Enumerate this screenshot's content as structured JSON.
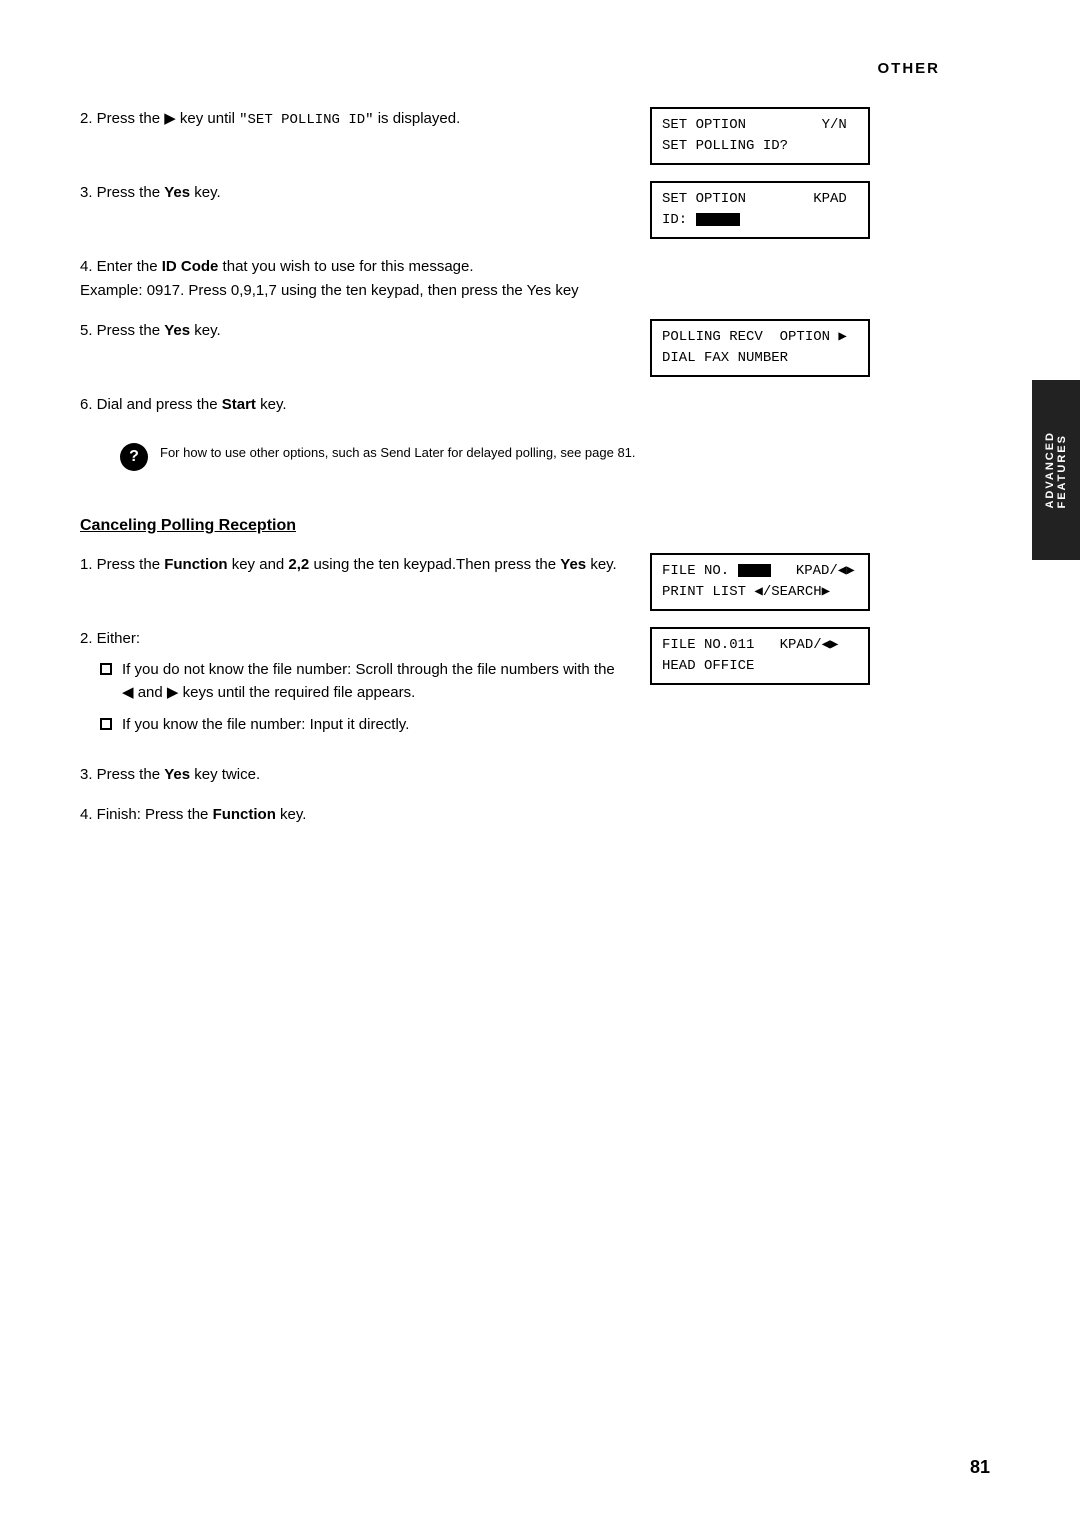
{
  "header": {
    "section": "OTHER"
  },
  "sidebar": {
    "text": "ADVANCED\nFEATURES"
  },
  "page_number": "81",
  "steps_part1": [
    {
      "id": "step2",
      "number": "2.",
      "text_before": "Press the ",
      "key_symbol": "▶",
      "text_after": " key until \"SET POLLING ID\" is displayed.",
      "lcd_lines": [
        "SET OPTION         Y/N",
        "SET POLLING ID?"
      ]
    },
    {
      "id": "step3",
      "number": "3.",
      "text": "Press the ",
      "bold": "Yes",
      "text2": " key.",
      "lcd_lines": [
        "SET OPTION        KPAD",
        "ID: ████"
      ]
    },
    {
      "id": "step4",
      "number": "4.",
      "text": "Enter the ",
      "bold": "ID Code",
      "text2": " that you wish to use for this message.\nExample: 0917. Press 0,9,1,7 using the ten keypad, then press the Yes key",
      "lcd_lines": []
    },
    {
      "id": "step5",
      "number": "5.",
      "text": "Press the ",
      "bold": "Yes",
      "text2": " key.",
      "lcd_lines": [
        "POLLING RECV  OPTION ▶",
        "DIAL FAX NUMBER"
      ]
    },
    {
      "id": "step6",
      "number": "6.",
      "text": "Dial and press the ",
      "bold": "Start",
      "text2": " key.",
      "lcd_lines": []
    }
  ],
  "info_box": {
    "symbol": "?",
    "text": "For how to use other options, such as Send Later for delayed polling, see page 81."
  },
  "section2_heading": "Canceling Polling Reception",
  "steps_part2": [
    {
      "id": "step2_1",
      "number": "1.",
      "text_before": "Press the ",
      "bold1": "Function",
      "text_mid": " key and ",
      "bold2": "2,2",
      "text_after": " using the ten keypad.Then press the ",
      "bold3": "Yes",
      "text_end": " key.",
      "lcd_lines": [
        "FILE NO. ███   KPAD/◀▶",
        "PRINT LIST ◀/SEARCH▶"
      ]
    },
    {
      "id": "step2_2",
      "number": "2.",
      "text": "Either:",
      "lcd_lines": [
        "FILE NO.011   KPAD/◀▶",
        "HEAD OFFICE"
      ],
      "bullets": [
        "If you do not know the file number: Scroll through the file numbers with the ◀ and ▶ keys until the required file appears.",
        "If you know the file number: Input it directly."
      ]
    },
    {
      "id": "step2_3",
      "number": "3.",
      "text_before": "Press the ",
      "bold1": "Yes",
      "text_after": " key twice.",
      "lcd_lines": []
    },
    {
      "id": "step2_4",
      "number": "4.",
      "text_before": "Finish: Press the ",
      "bold1": "Function",
      "text_after": " key.",
      "lcd_lines": []
    }
  ]
}
